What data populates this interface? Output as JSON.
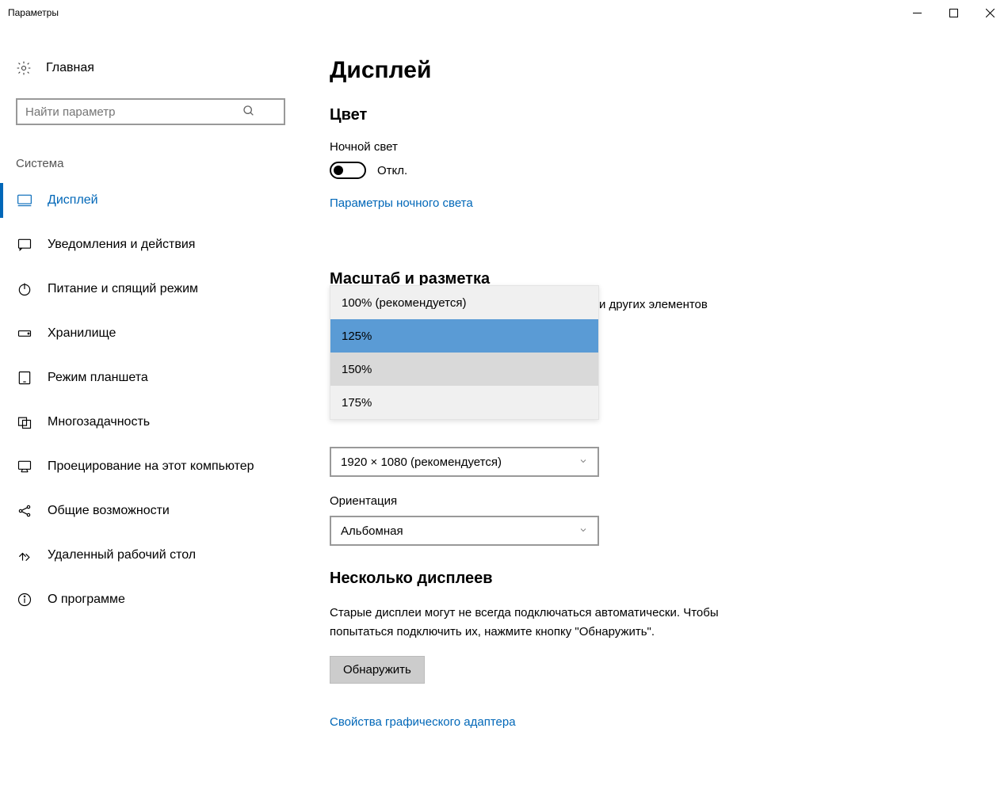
{
  "titlebar": {
    "title": "Параметры"
  },
  "sidebar": {
    "home": "Главная",
    "search_placeholder": "Найти параметр",
    "group_title": "Система",
    "items": [
      {
        "id": "display",
        "label": "Дисплей",
        "active": true
      },
      {
        "id": "notifications",
        "label": "Уведомления и действия",
        "active": false
      },
      {
        "id": "power",
        "label": "Питание и спящий режим",
        "active": false
      },
      {
        "id": "storage",
        "label": "Хранилище",
        "active": false
      },
      {
        "id": "tablet",
        "label": "Режим планшета",
        "active": false
      },
      {
        "id": "multitask",
        "label": "Многозадачность",
        "active": false
      },
      {
        "id": "projecting",
        "label": "Проецирование на этот компьютер",
        "active": false
      },
      {
        "id": "shared",
        "label": "Общие возможности",
        "active": false
      },
      {
        "id": "remote",
        "label": "Удаленный рабочий стол",
        "active": false
      },
      {
        "id": "about",
        "label": "О программе",
        "active": false
      }
    ]
  },
  "main": {
    "page_title": "Дисплей",
    "color": {
      "heading": "Цвет",
      "nightlight_label": "Ночной свет",
      "toggle_state": "Откл.",
      "nightlight_link": "Параметры ночного света"
    },
    "scale": {
      "heading": "Масштаб и разметка",
      "behind_text": "и других элементов",
      "options": [
        {
          "label": "100% (рекомендуется)",
          "selected": false,
          "hover": false
        },
        {
          "label": "125%",
          "selected": true,
          "hover": false
        },
        {
          "label": "150%",
          "selected": false,
          "hover": true
        },
        {
          "label": "175%",
          "selected": false,
          "hover": false
        }
      ],
      "resolution_value": "1920 × 1080 (рекомендуется)",
      "orientation_label": "Ориентация",
      "orientation_value": "Альбомная"
    },
    "multi": {
      "heading": "Несколько дисплеев",
      "paragraph": "Старые дисплеи могут не всегда подключаться автоматически. Чтобы попытаться подключить их, нажмите кнопку \"Обнаружить\".",
      "detect_button": "Обнаружить",
      "adapter_link": "Свойства графического адаптера"
    }
  }
}
